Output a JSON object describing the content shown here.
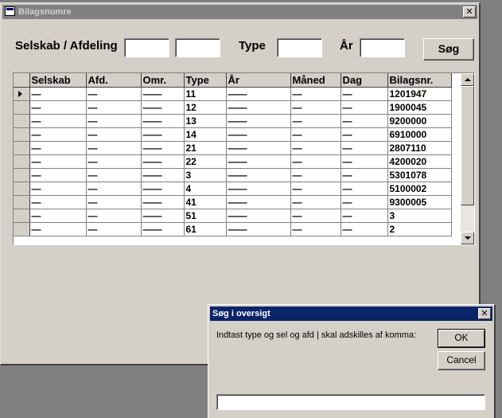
{
  "main_window": {
    "title": "Bilagsnumre",
    "close_glyph": "✕",
    "labels": {
      "selskab_afdeling": "Selskab / Afdeling",
      "type": "Type",
      "year": "År"
    },
    "fields": {
      "selskab": "",
      "afdeling": "",
      "type": "",
      "year": ""
    },
    "search_button": "Søg"
  },
  "grid": {
    "columns": [
      "Selskab",
      "Afd.",
      "Omr.",
      "Type",
      "År",
      "Måned",
      "Dag",
      "Bilagsnr."
    ],
    "current_row": 0,
    "rows": [
      [
        "—",
        "—",
        "——",
        "11",
        "——",
        "—",
        "—",
        "1201947"
      ],
      [
        "—",
        "—",
        "——",
        "12",
        "——",
        "—",
        "—",
        "1900045"
      ],
      [
        "—",
        "—",
        "——",
        "13",
        "——",
        "—",
        "—",
        "9200000"
      ],
      [
        "—",
        "—",
        "——",
        "14",
        "——",
        "—",
        "—",
        "6910000"
      ],
      [
        "—",
        "—",
        "——",
        "21",
        "——",
        "—",
        "—",
        "2807110"
      ],
      [
        "—",
        "—",
        "——",
        "22",
        "——",
        "—",
        "—",
        "4200020"
      ],
      [
        "—",
        "—",
        "——",
        "3",
        "——",
        "—",
        "—",
        "5301078"
      ],
      [
        "—",
        "—",
        "——",
        "4",
        "——",
        "—",
        "—",
        "5100002"
      ],
      [
        "—",
        "—",
        "——",
        "41",
        "——",
        "—",
        "—",
        "9300005"
      ],
      [
        "—",
        "—",
        "——",
        "51",
        "——",
        "—",
        "—",
        "3"
      ],
      [
        "—",
        "—",
        "——",
        "61",
        "——",
        "—",
        "—",
        "2"
      ]
    ],
    "scroll_position": 0.0
  },
  "dialog": {
    "title": "Søg i oversigt",
    "close_glyph": "✕",
    "prompt": "Indtast type og sel og afd | skal adskilles af komma:",
    "ok_button": "OK",
    "cancel_button": "Cancel",
    "input_value": ""
  },
  "colors": {
    "window_face": "#d4d0c8",
    "inactive_title": "#808080",
    "active_title": "#0a246a",
    "desktop": "#808080"
  }
}
